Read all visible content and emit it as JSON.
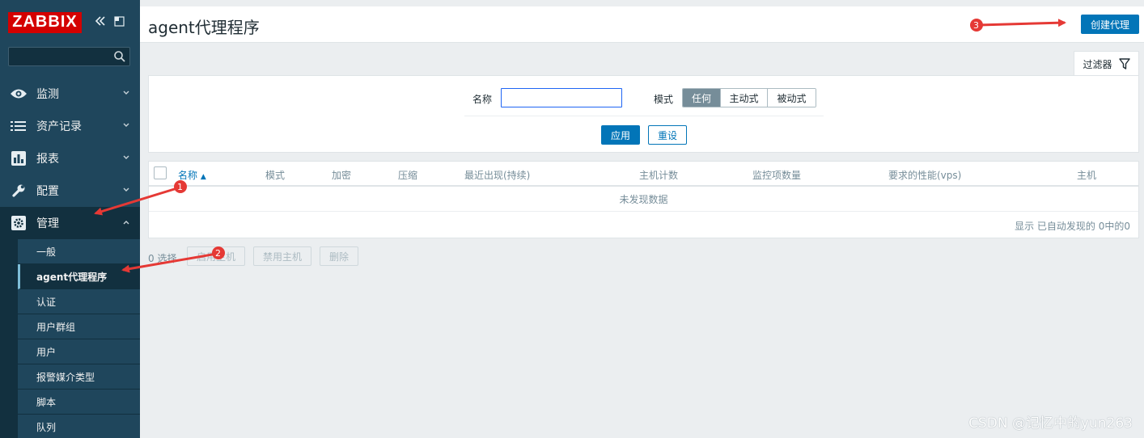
{
  "app": {
    "logo": "ZABBIX"
  },
  "sidebar": {
    "search_placeholder": "",
    "menu": [
      {
        "label": "监测",
        "icon": "eye-icon"
      },
      {
        "label": "资产记录",
        "icon": "list-icon"
      },
      {
        "label": "报表",
        "icon": "bar-chart-icon"
      },
      {
        "label": "配置",
        "icon": "wrench-icon"
      },
      {
        "label": "管理",
        "icon": "gear-icon"
      }
    ],
    "submenu": [
      "一般",
      "agent代理程序",
      "认证",
      "用户群组",
      "用户",
      "报警媒介类型",
      "脚本",
      "队列"
    ]
  },
  "header": {
    "title": "agent代理程序",
    "create_label": "创建代理"
  },
  "filter": {
    "tab_label": "过滤器",
    "name_label": "名称",
    "name_value": "",
    "mode_label": "模式",
    "modes": [
      "任何",
      "主动式",
      "被动式"
    ],
    "apply_label": "应用",
    "reset_label": "重设"
  },
  "table": {
    "columns": [
      "名称",
      "模式",
      "加密",
      "压缩",
      "最近出现(持续)",
      "主机计数",
      "监控项数量",
      "要求的性能(vps)",
      "主机"
    ],
    "empty_text": "未发现数据",
    "paging_text": "显示 已自动发现的 0中的0"
  },
  "actions": {
    "selected": "0 选择",
    "enable": "启用主机",
    "disable": "禁用主机",
    "delete": "删除"
  },
  "annotations": [
    "1",
    "2",
    "3"
  ],
  "watermark": "CSDN @记忆中的yun263",
  "colors": {
    "sidebar": "#1f465c",
    "sidebar_dark": "#12303f",
    "logo_red": "#d40000",
    "primary": "#0275b8",
    "arrow_red": "#e53935"
  }
}
